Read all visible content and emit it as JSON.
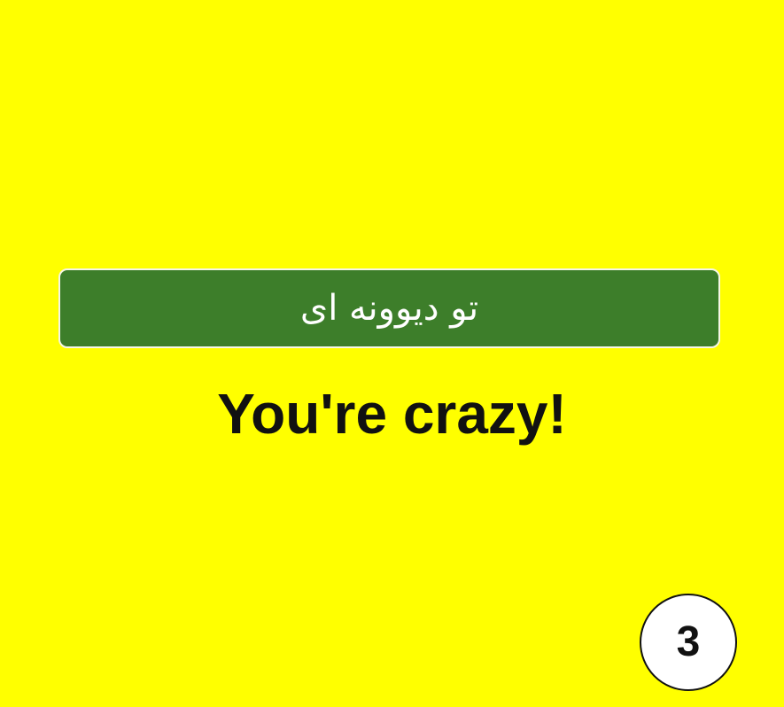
{
  "phrase": {
    "persian": "تو دیوونه ای",
    "english": "You're crazy!"
  },
  "page": {
    "number": "3"
  },
  "colors": {
    "background": "#ffff00",
    "banner": "#3d7e2a",
    "banner_text": "#ffffff",
    "text": "#111111",
    "badge_background": "#ffffff"
  }
}
